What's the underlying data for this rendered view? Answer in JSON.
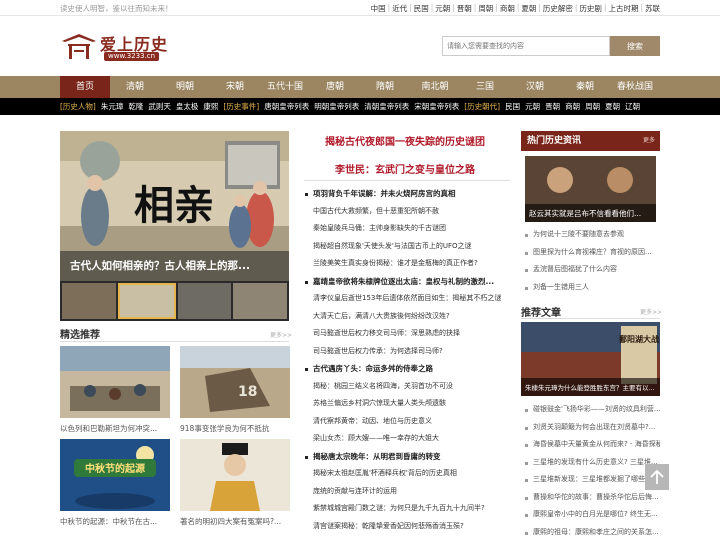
{
  "topbar": {
    "slogan": "读史使人明智，鉴以往而知未来！",
    "links": [
      "中国",
      "近代",
      "民国",
      "元朝",
      "晋朝",
      "周朝",
      "商朝",
      "夏朝",
      "历史解密",
      "历史剧",
      "上古时期",
      "苏联"
    ]
  },
  "header": {
    "logo_name": "爱上历史",
    "logo_url": "www.3233.cn",
    "search_placeholder": "请输入您需要查找的内容",
    "search_button": "搜索"
  },
  "nav": {
    "items": [
      "首页",
      "清朝",
      "明朝",
      "宋朝",
      "五代十国",
      "唐朝",
      "隋朝",
      "南北朝",
      "三国",
      "汉朝",
      "秦朝",
      "春秋战国"
    ]
  },
  "subnav": {
    "items": [
      {
        "label": "[历史人物]",
        "cat": true
      },
      {
        "label": "朱元璋"
      },
      {
        "label": "乾隆"
      },
      {
        "label": "武则天"
      },
      {
        "label": "皇太极"
      },
      {
        "label": "康熙"
      },
      {
        "label": "[历史事件]",
        "cat": true
      },
      {
        "label": "唐朝皇帝列表"
      },
      {
        "label": "明朝皇帝列表"
      },
      {
        "label": "清朝皇帝列表"
      },
      {
        "label": "宋朝皇帝列表"
      },
      {
        "label": "[历史朝代]",
        "cat": true
      },
      {
        "label": "民国"
      },
      {
        "label": "元朝"
      },
      {
        "label": "晋朝"
      },
      {
        "label": "商朝"
      },
      {
        "label": "周朝"
      },
      {
        "label": "夏朝"
      },
      {
        "label": "辽朝"
      }
    ]
  },
  "hero": {
    "title_text": "相亲",
    "caption": "古代人如何相亲的？古人相亲上的那..."
  },
  "featured": {
    "title": "精选推荐",
    "more": "更多>>",
    "cards": [
      {
        "caption": "以色列和巴勒斯坦为何冲突..."
      },
      {
        "caption": "918事变张学良为何不抵抗"
      },
      {
        "caption": "中秋节的起源：中秋节在古...",
        "img_text": "中秋节的起源"
      },
      {
        "caption": "著名的明初四大案有冤案吗?..."
      }
    ]
  },
  "center": {
    "headline1": "揭秘古代夜郎国一夜失踪的历史谜团",
    "headline2": "李世民：玄武门之变与皇位之路",
    "groups": [
      {
        "title": "项羽背负千年误解：并未火烧阿房宫的真相",
        "items": [
          "中国古代大救频繁，但十恶重犯所朝不赦",
          "秦始皇陵兵马俑：主帅身影缺失的千古谜团",
          "揭秘超自然现象'天使头发'与法国古币上的UFO之谜",
          "兰陵美笑生真实身份揭秘：谁才是金瓶梅的真正作者?"
        ]
      },
      {
        "title": "嘉靖皇帝欲将朱棣牌位逐出太庙：皇权与礼制的激烈...",
        "items": [
          "清李仪皇后逝世153年后遗体依然面目如生：揭秘其不朽之谜",
          "大清天亡后，满清八大贵族後何纷纷改汉姓?",
          "司马懿逝世后权力移交司马师：深思熟虑的抉择",
          "司马懿逝世后权力传承：为何选择司马师?"
        ]
      },
      {
        "title": "古代遇房丫头：命运多舛的侍奉之路",
        "items": [
          "揭秘：桃园三结义名将四海，关羽首功不可没",
          "苏格兰偏远乡村洞穴惊现大量人类头颅遗骸",
          "清代察邦黄帝：动因、地位与历史意义",
          "梁山女杰：顾大嫂——唯一幸存的大姐大"
        ]
      },
      {
        "title": "揭秘唐太宗晚年：从明君到昏庸的转变",
        "items": [
          "揭秘宋太祖赵匡胤'杯酒释兵权'背后的历史真相",
          "庞统的贡献与连环计的运用",
          "紫禁城城宫殿门数之谜：为何只是九千九百九十九间半?",
          "清宫谜案揭秘：乾隆挚爱香妃因何悲殇香消玉殒?"
        ]
      }
    ]
  },
  "right": {
    "hot_title": "热门历史资讯",
    "hot_more": "更多",
    "hot_img_caption": "赵云其实就是吕布不信看看他们...",
    "hot_items": [
      "为何说十三陵不要随意去参观",
      "图里探为什么育视裸庄？育视的原因...",
      "孟浣督后图福犹了什么内容",
      "刘备一生错用三人"
    ],
    "rec_title": "推荐文章",
    "rec_more": "更多>>",
    "rec_img_caption": "朱棣朱元璋为什么能登胜胜东宫？主要有以...",
    "rec_img_text": "鄱阳湖大战",
    "rec_items": [
      "碰银鼓金'飞扬华彩——刘贤的纹具利营...",
      "刘贤关羽颠簸为何会出现在刘贤墓中?...",
      "海昏侯墓中天量黄金从何而来? - 海昏探秘",
      "三星堆的发现有什么历史意义? 三星堆...",
      "三星堆新发现：三星堆都发掘了哪些文...",
      "曹操和华佗的故事：曹操杀华佗后后悔...",
      "康熙皇帝小中的白月光是哪位? 终生无...",
      "康熙的祖母：康熙和孝庄之间的关系怎..."
    ]
  },
  "colors": {
    "brand": "#7a2519",
    "nav_bg": "#9b8661",
    "headline_red": "#b0192a",
    "subnav_cat": "#e6b44d"
  }
}
